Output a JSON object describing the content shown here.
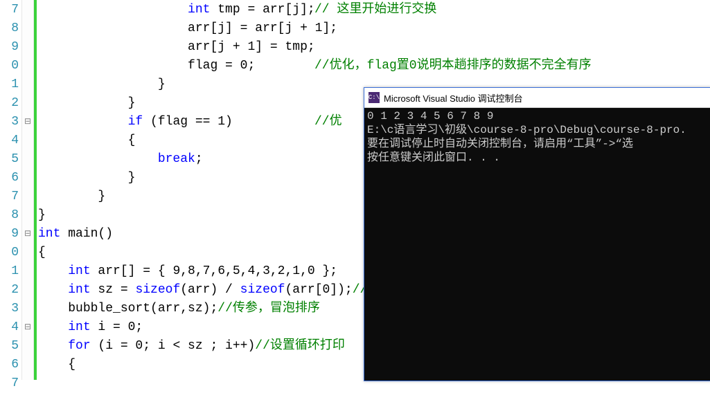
{
  "editor": {
    "line_numbers": [
      "7",
      "8",
      "9",
      "0",
      "1",
      "2",
      "3",
      "4",
      "5",
      "6",
      "7",
      "8",
      "9",
      "0",
      "1",
      "2",
      "3",
      "4",
      "5",
      "6",
      "7"
    ],
    "fold_marks": [
      "",
      "",
      "",
      "",
      "",
      "",
      "⊟",
      "",
      "",
      "",
      "",
      "",
      "⊟",
      "",
      "",
      "",
      "",
      "⊟",
      "",
      "",
      ""
    ],
    "lines": [
      {
        "indent": "                    ",
        "tokens": [
          {
            "t": "int",
            "c": "kw"
          },
          {
            "t": " tmp = arr[j];"
          }
        ],
        "comment_col": 452,
        "comment": "// 这里开始进行交换"
      },
      {
        "indent": "                    ",
        "tokens": [
          {
            "t": "arr[j] = arr[j + 1];"
          }
        ]
      },
      {
        "indent": "                    ",
        "tokens": [
          {
            "t": "arr[j + 1] = tmp;"
          }
        ]
      },
      {
        "indent": "                    ",
        "tokens": [
          {
            "t": "flag = 0;"
          }
        ],
        "comment_col": 452,
        "comment": "//优化，flag置0说明本趟排序的数据不完全有序"
      },
      {
        "indent": "                ",
        "tokens": [
          {
            "t": "}"
          }
        ]
      },
      {
        "indent": "            ",
        "tokens": [
          {
            "t": "}"
          }
        ]
      },
      {
        "indent": "            ",
        "tokens": [
          {
            "t": "if",
            "c": "kw"
          },
          {
            "t": " (flag == 1)"
          }
        ],
        "comment_col": 452,
        "comment": "//优"
      },
      {
        "indent": "            ",
        "tokens": [
          {
            "t": "{"
          }
        ]
      },
      {
        "indent": "                ",
        "tokens": [
          {
            "t": "break",
            "c": "kw"
          },
          {
            "t": ";"
          }
        ]
      },
      {
        "indent": "            ",
        "tokens": [
          {
            "t": "}"
          }
        ]
      },
      {
        "indent": "        ",
        "tokens": [
          {
            "t": "}"
          }
        ]
      },
      {
        "indent": "",
        "tokens": [
          {
            "t": "}"
          }
        ]
      },
      {
        "indent": "",
        "tokens": [
          {
            "t": "int",
            "c": "kw"
          },
          {
            "t": " main()"
          }
        ]
      },
      {
        "indent": "",
        "tokens": [
          {
            "t": "{"
          }
        ]
      },
      {
        "indent": "    ",
        "tokens": [
          {
            "t": "int",
            "c": "kw"
          },
          {
            "t": " arr[] = { 9,8,7,6,5,4,3,2,1,0 };"
          }
        ]
      },
      {
        "indent": "    ",
        "tokens": [
          {
            "t": "int",
            "c": "kw"
          },
          {
            "t": " sz = "
          },
          {
            "t": "sizeof",
            "c": "sz"
          },
          {
            "t": "(arr) / "
          },
          {
            "t": "sizeof",
            "c": "sz"
          },
          {
            "t": "(arr[0]);"
          }
        ],
        "comment_inline": "//"
      },
      {
        "indent": "    ",
        "tokens": [
          {
            "t": "bubble_sort(arr,sz);"
          }
        ],
        "comment_inline": "//传参，冒泡排序"
      },
      {
        "indent": "    ",
        "tokens": [
          {
            "t": "int",
            "c": "kw"
          },
          {
            "t": " i = 0;"
          }
        ]
      },
      {
        "indent": "    ",
        "tokens": [
          {
            "t": "for",
            "c": "kw"
          },
          {
            "t": " (i = 0; i < sz ; i++)"
          }
        ],
        "comment_inline": "//设置循环打印"
      },
      {
        "indent": "    ",
        "tokens": [
          {
            "t": "{"
          }
        ]
      },
      {
        "indent": "        ",
        "tokens": [
          {
            "t": ""
          }
        ]
      }
    ]
  },
  "console": {
    "title": "Microsoft Visual Studio 调试控制台",
    "icon_text": "C:\\",
    "lines": [
      "0 1 2 3 4 5 6 7 8 9",
      "E:\\c语言学习\\初级\\course-8-pro\\Debug\\course-8-pro.",
      "要在调试停止时自动关闭控制台，请启用“工具”->“选",
      "按任意键关闭此窗口. . ."
    ]
  }
}
